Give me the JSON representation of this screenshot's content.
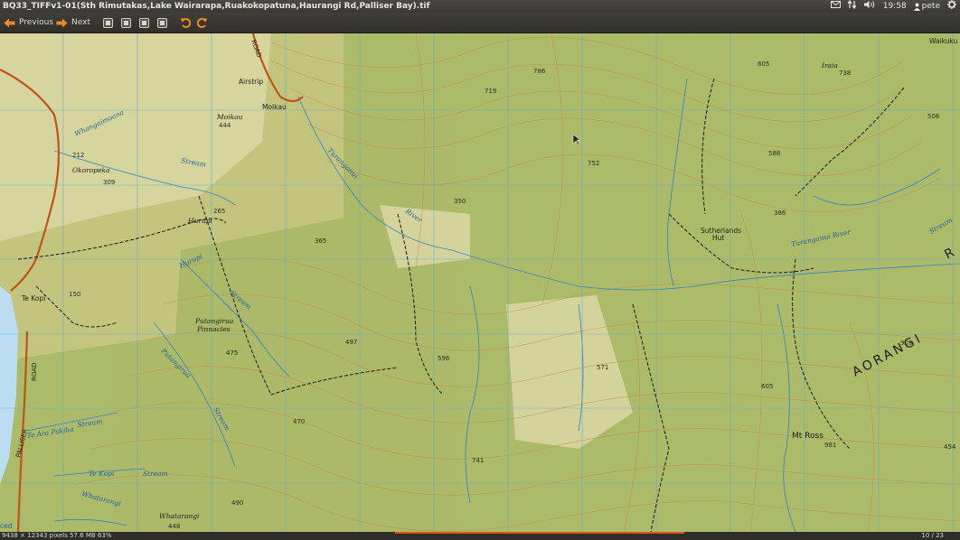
{
  "window": {
    "title": "BQ33_TIFFv1-01(Sth Rimutakas,Lake Wairarapa,Ruakokopatuna,Haurangi Rd,Palliser Bay).tif"
  },
  "tray": {
    "clock": "19:58",
    "user": "pete"
  },
  "toolbar": {
    "previous_label": "Previous",
    "next_label": "Next"
  },
  "statusbar": {
    "info": "9438 × 12343 pixels  57.6 MB  63%",
    "page": "10 / 23"
  },
  "map": {
    "labels": {
      "airstrip": "Airstrip",
      "moikau": "Moikau",
      "moikau_peak": "Moikau",
      "h444": "444",
      "h212": "212",
      "okoropeka": "Okoropeka",
      "h309": "309",
      "whangaimoana": "Whangaimoana",
      "stream1": "Stream",
      "huruplnote": "Hurupi",
      "h265": "265",
      "h365": "365",
      "h719": "719",
      "h786": "786",
      "h752": "752",
      "h350": "350",
      "turanganui": "Turanganui",
      "river": "River",
      "h605a": "605",
      "iraia": "Iraia",
      "h738": "738",
      "waikuku": "Waikuku Lo",
      "h506": "506",
      "h588": "588",
      "h386": "386",
      "sutherlands": "Sutherlands",
      "hut": "Hut",
      "turanganui_river2": "Turanganui River",
      "stream_right": "Stream",
      "tekopi": "Te Kopi",
      "h150": "150",
      "hurupi_stream": "Hurupi",
      "stream2": "Stream",
      "putangirua": "Putangirua",
      "pinnacles": "Pinnacles",
      "h475": "475",
      "h497": "497",
      "h596": "596",
      "h571": "571",
      "aorangi": "AORANGI",
      "h905": "905",
      "h605b": "605",
      "mtross": "Mt Ross",
      "h981": "981",
      "h454": "454",
      "putangirua_stream": "Putangirua",
      "stream3": "Stream",
      "h470": "470",
      "h741": "741",
      "tearapakiha": "Te Ara Pakiha",
      "stream4": "Stream",
      "tekopi_stream": "Te Kopi",
      "stream5": "Stream",
      "whatarangi_stream": "Whatarangi",
      "h490": "490",
      "whatarangi": "Whatarangi",
      "h448": "448",
      "road_top": "ROAD",
      "road_left": "ROAD",
      "palliser": "PALLISER",
      "coast_text": "ced",
      "right_r": "R"
    }
  },
  "colors": {
    "terrain": "#c3c57f",
    "forest": "#a9b86a",
    "contour": "#c8873b",
    "water": "#2f83c4",
    "grid": "#5aa7d6",
    "road": "#c0531a",
    "lake": "#bcdcf2"
  },
  "icons": {
    "previous": "arrow-left-icon",
    "next": "arrow-right-icon",
    "rotate_left": "rotate-left-icon",
    "rotate_right": "rotate-right-icon",
    "mail": "mail-icon",
    "network": "network-icon",
    "volume": "volume-icon",
    "user": "user-icon",
    "settings": "gear-icon"
  }
}
